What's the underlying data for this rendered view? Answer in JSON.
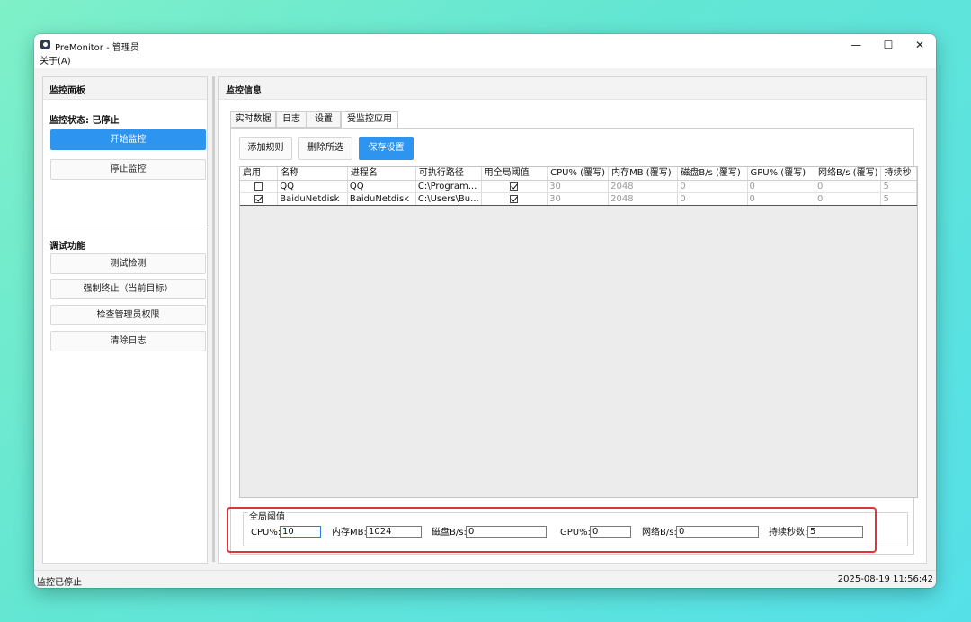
{
  "window": {
    "title": "PreMonitor - 管理员",
    "controls": {
      "minimize": "—",
      "maximize": "☐",
      "close": "✕"
    }
  },
  "menu": {
    "about": "关于(A)"
  },
  "left_panel": {
    "title": "监控面板",
    "status_label": "监控状态: 已停止",
    "start_button": "开始监控",
    "stop_button": "停止监控",
    "debug_title": "调试功能",
    "debug_buttons": [
      "测试检测",
      "强制终止（当前目标）",
      "检查管理员权限",
      "清除日志"
    ]
  },
  "right_panel": {
    "title": "监控信息",
    "tabs": [
      "实时数据",
      "日志",
      "设置",
      "受监控应用"
    ],
    "active_tab": 3,
    "toolbar": {
      "add": "添加规则",
      "delete": "删除所选",
      "save": "保存设置"
    }
  },
  "table": {
    "columns": [
      "启用",
      "名称",
      "进程名",
      "可执行路径",
      "用全局阈值",
      "CPU% (覆写)",
      "内存MB (覆写)",
      "磁盘B/s (覆写)",
      "GPU% (覆写)",
      "网络B/s (覆写)",
      "持续秒"
    ],
    "rows": [
      {
        "enabled": false,
        "name": "QQ",
        "process": "QQ",
        "path": "C:\\Program...",
        "use_global": true,
        "cpu": "30",
        "mem": "2048",
        "disk": "0",
        "gpu": "0",
        "net": "0",
        "dur": "5"
      },
      {
        "enabled": true,
        "name": "BaiduNetdisk",
        "process": "BaiduNetdisk",
        "path": "C:\\Users\\Bu...",
        "use_global": true,
        "cpu": "30",
        "mem": "2048",
        "disk": "0",
        "gpu": "0",
        "net": "0",
        "dur": "5"
      }
    ]
  },
  "global_thresholds": {
    "title": "全局阈值",
    "cpu_label": "CPU%:",
    "cpu_value": "10",
    "mem_label": "内存MB:",
    "mem_value": "1024",
    "disk_label": "磁盘B/s:",
    "disk_value": "0",
    "gpu_label": "GPU%:",
    "gpu_value": "0",
    "net_label": "网络B/s:",
    "net_value": "0",
    "dur_label": "持续秒数:",
    "dur_value": "5"
  },
  "statusbar": {
    "left": "监控已停止",
    "right": "2025-08-19 11:56:42"
  },
  "colors": {
    "accent": "#2d94f0",
    "highlight": "#d9363e"
  }
}
